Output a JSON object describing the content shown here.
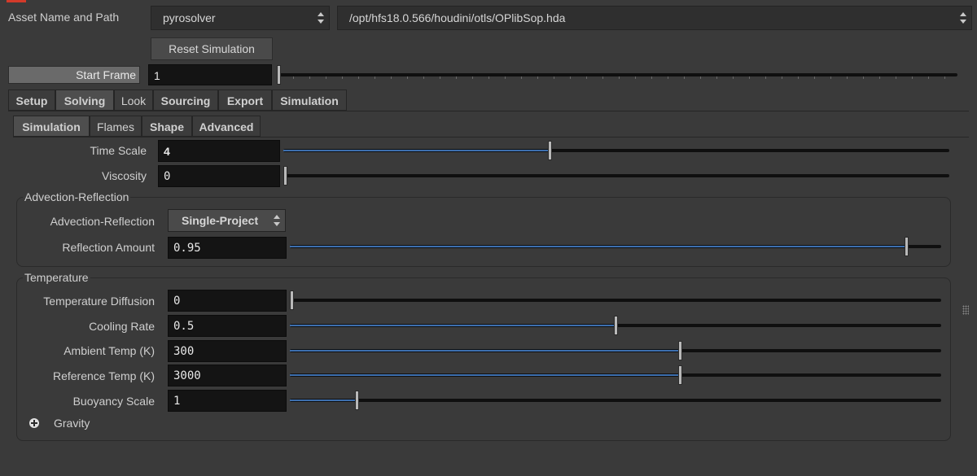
{
  "header": {
    "asset_label": "Asset Name and Path",
    "asset_name": "pyrosolver",
    "asset_path": "/opt/hfs18.0.566/houdini/otls/OPlibSop.hda",
    "reset_button": "Reset Simulation",
    "start_frame_label": "Start Frame",
    "start_frame_value": "1",
    "start_frame_fraction": 0.0
  },
  "main_tabs": [
    {
      "label": "Setup",
      "bold": true
    },
    {
      "label": "Solving",
      "bold": true,
      "active": true
    },
    {
      "label": "Look",
      "bold": false
    },
    {
      "label": "Sourcing",
      "bold": true
    },
    {
      "label": "Export",
      "bold": true
    },
    {
      "label": "Simulation",
      "bold": true
    }
  ],
  "sub_tabs": [
    {
      "label": "Simulation",
      "bold": true,
      "active": true
    },
    {
      "label": "Flames",
      "bold": false
    },
    {
      "label": "Shape",
      "bold": true
    },
    {
      "label": "Advanced",
      "bold": true
    }
  ],
  "params": {
    "time_scale": {
      "label": "Time Scale",
      "value": "4",
      "fraction": 0.4
    },
    "viscosity": {
      "label": "Viscosity",
      "value": "0",
      "fraction": 0.0
    }
  },
  "advection": {
    "group_title": "Advection-Reflection",
    "mode_label": "Advection-Reflection",
    "mode_value": "Single-Project",
    "reflection": {
      "label": "Reflection Amount",
      "value": "0.95",
      "fraction": 0.95
    }
  },
  "temperature": {
    "group_title": "Temperature",
    "rows": [
      {
        "label": "Temperature Diffusion",
        "value": "0",
        "fraction": 0.0
      },
      {
        "label": "Cooling Rate",
        "value": "0.5",
        "fraction": 0.5
      },
      {
        "label": "Ambient Temp (K)",
        "value": "300",
        "fraction": 0.6
      },
      {
        "label": "Reference Temp (K)",
        "value": "3000",
        "fraction": 0.6
      },
      {
        "label": "Buoyancy Scale",
        "value": "1",
        "fraction": 0.1
      }
    ],
    "gravity_label": "Gravity"
  },
  "colors": {
    "slider_fill": "#3d6fae",
    "background": "#3a3a3a",
    "field": "#141414"
  }
}
